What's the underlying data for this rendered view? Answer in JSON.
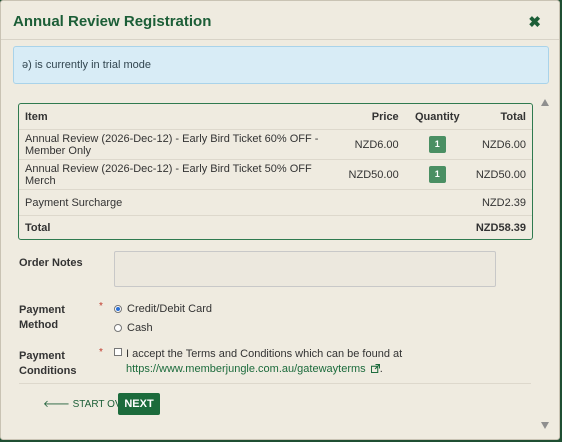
{
  "modal": {
    "title": "Annual Review Registration",
    "close_icon": "close-icon",
    "trial_notice": "ə) is currently in trial mode"
  },
  "order": {
    "headers": [
      "Item",
      "Price",
      "Quantity",
      "Total"
    ],
    "rows": [
      {
        "item": "Annual Review (2026-Dec-12) - Early Bird Ticket 60% OFF - Member Only",
        "price": "NZD6.00",
        "quantity": "1",
        "total": "NZD6.00"
      },
      {
        "item": "Annual Review (2026-Dec-12) - Early Bird Ticket 50% OFF Merch",
        "price": "NZD50.00",
        "quantity": "1",
        "total": "NZD50.00"
      }
    ],
    "surcharge_label": "Payment Surcharge",
    "surcharge_value": "NZD2.39",
    "total_label": "Total",
    "total_value": "NZD58.39"
  },
  "form": {
    "order_notes_label": "Order Notes",
    "payment_method_label_1": "Payment",
    "payment_method_label_2": "Method",
    "required_mark": "*",
    "payment_options": [
      {
        "label": "Credit/Debit Card",
        "selected": true
      },
      {
        "label": "Cash",
        "selected": false
      }
    ],
    "payment_conditions_label_1": "Payment",
    "payment_conditions_label_2": "Conditions",
    "terms_text": "I accept the Terms and Conditions which can be found at",
    "terms_link": "https://www.memberjungle.com.au/gatewayterms",
    "terms_end": "."
  },
  "actions": {
    "start_over": "START OVER",
    "next": "NEXT"
  },
  "colors": {
    "brand_green": "#1c6b3c",
    "notice_bg": "#d8ecf6",
    "modal_bg": "#efebe0"
  }
}
